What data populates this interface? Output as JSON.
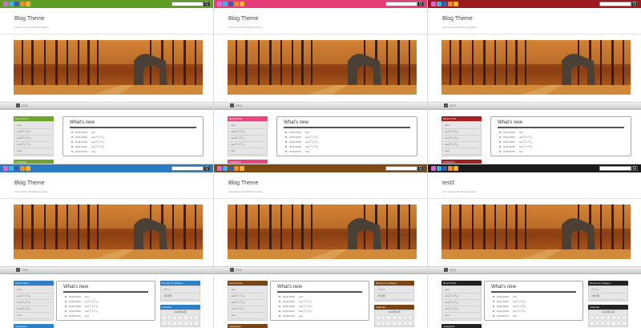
{
  "site": {
    "tagline": "Just another WordPress weblog",
    "whats_new_title": "What’s new",
    "menu_items": [
      "test",
      "testアイテム",
      "testアイテム",
      "testアイテム",
      "test"
    ],
    "recent_heading": "Recent Post",
    "categories_heading": "Categories",
    "browse_heading": "Browse by category",
    "browse_items": [
      "テスト",
      "未分類"
    ],
    "calendar_heading": "Calendar",
    "calendar_month": "2011年10月",
    "news": [
      {
        "date": "2011/10/20",
        "title": "test"
      },
      {
        "date": "2011/10/20",
        "title": "testアイテム"
      },
      {
        "date": "2011/10/20",
        "title": "testアイテム"
      },
      {
        "date": "2011/10/20",
        "title": "testアイテム"
      },
      {
        "date": "2011/07/26",
        "title": "test"
      }
    ],
    "search_button": "Q",
    "nav_rss": "RSS"
  },
  "tiles": [
    {
      "theme": "green",
      "title": "Blog Theme",
      "accent": "#6da42a",
      "topbar": "#5f9e26",
      "right_column": false
    },
    {
      "theme": "pink",
      "title": "Blog Theme",
      "accent": "#e8467f",
      "topbar": "#e63c78",
      "right_column": false
    },
    {
      "theme": "red",
      "title": "Blog Theme",
      "accent": "#a41e22",
      "topbar": "#9d1b1f",
      "right_column": false
    },
    {
      "theme": "blue",
      "title": "Blog Theme",
      "accent": "#2e7fc4",
      "topbar": "#2b7bc3",
      "right_column": true
    },
    {
      "theme": "brown",
      "title": "Blog Theme",
      "accent": "#7a4514",
      "topbar": "#7d4a12",
      "right_column": true
    },
    {
      "theme": "black",
      "title": "test2",
      "accent": "#222222",
      "topbar": "#1b1b1b",
      "right_column": true
    }
  ],
  "icons": [
    "home-icon",
    "twitter-icon",
    "facebook-icon",
    "rss-icon",
    "mail-icon"
  ]
}
